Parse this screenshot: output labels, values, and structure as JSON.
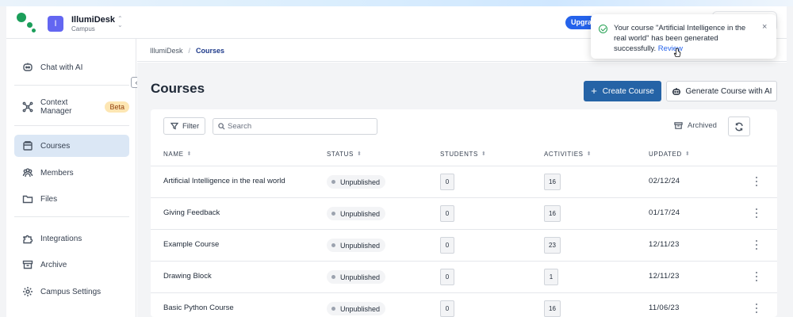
{
  "workspace": {
    "avatar_letter": "I",
    "name": "IllumiDesk",
    "subtitle": "Campus"
  },
  "topbar": {
    "upgrade_label": "Upgrade"
  },
  "sidebar": {
    "chat": "Chat with AI",
    "context_manager": "Context Manager",
    "beta_badge": "Beta",
    "items": [
      {
        "label": "Courses",
        "icon": "book-icon",
        "active": true
      },
      {
        "label": "Members",
        "icon": "users-icon",
        "active": false
      },
      {
        "label": "Files",
        "icon": "folder-icon",
        "active": false
      }
    ],
    "bottom_items": [
      {
        "label": "Integrations",
        "icon": "puzzle-icon"
      },
      {
        "label": "Archive",
        "icon": "archive-icon"
      },
      {
        "label": "Campus Settings",
        "icon": "gear-icon"
      }
    ]
  },
  "breadcrumb": {
    "root": "IllumiDesk",
    "separator": "/",
    "current": "Courses"
  },
  "page": {
    "title": "Courses",
    "create_button": "Create Course",
    "generate_button": "Generate Course with AI"
  },
  "toolbar": {
    "filter_label": "Filter",
    "search_placeholder": "Search",
    "archived_label": "Archived"
  },
  "table": {
    "headers": {
      "name": "NAME",
      "status": "STATUS",
      "students": "STUDENTS",
      "activities": "ACTIVITIES",
      "updated": "UPDATED"
    },
    "rows": [
      {
        "name": "Artificial Intelligence in the real world",
        "status": "Unpublished",
        "students": "0",
        "activities": "16",
        "updated": "02/12/24"
      },
      {
        "name": "Giving Feedback",
        "status": "Unpublished",
        "students": "0",
        "activities": "16",
        "updated": "01/17/24"
      },
      {
        "name": "Example Course",
        "status": "Unpublished",
        "students": "0",
        "activities": "23",
        "updated": "12/11/23"
      },
      {
        "name": "Drawing Block",
        "status": "Unpublished",
        "students": "0",
        "activities": "1",
        "updated": "12/11/23"
      },
      {
        "name": "Basic Python Course",
        "status": "Unpublished",
        "students": "0",
        "activities": "16",
        "updated": "11/06/23"
      }
    ]
  },
  "toast": {
    "message": "Your course \"Artificial Intelligence in the real world\" has been generated successfully.",
    "link_label": "Review",
    "close_label": "×"
  },
  "colors": {
    "accent": "#2563a6",
    "brand_green": "#1b9e5a",
    "active_nav": "#dbe7f5",
    "success": "#22a050"
  }
}
